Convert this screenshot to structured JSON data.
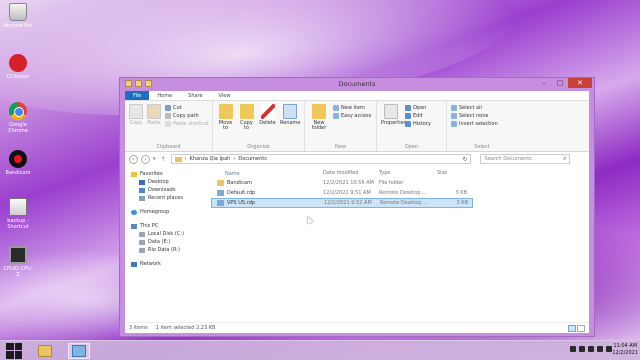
{
  "desktop": {
    "icons": [
      {
        "label": "Recycle Bin"
      },
      {
        "label": "CCleaner"
      },
      {
        "label": "Google Chrome"
      },
      {
        "label": "Bandicam"
      },
      {
        "label": "backup - Shortcut"
      },
      {
        "label": "CPUID CPU-Z"
      }
    ]
  },
  "window": {
    "title": "Documents",
    "tabs": [
      "File",
      "Home",
      "Share",
      "View"
    ],
    "ribbon": {
      "clipboard": {
        "name": "Clipboard",
        "copy": "Copy",
        "paste": "Paste",
        "cut": "Cut",
        "copy_path": "Copy path",
        "paste_shortcut": "Paste shortcut"
      },
      "organize": {
        "name": "Organize",
        "move_to": "Move to",
        "copy_to": "Copy to",
        "delete": "Delete",
        "rename": "Rename"
      },
      "new": {
        "name": "New",
        "new_folder": "New folder",
        "new_item": "New item",
        "easy_access": "Easy access"
      },
      "open": {
        "name": "Open",
        "properties": "Properties",
        "open": "Open",
        "edit": "Edit",
        "history": "History"
      },
      "select": {
        "name": "Select",
        "select_all": "Select all",
        "select_none": "Select none",
        "invert_selection": "Invert selection"
      }
    },
    "address": {
      "path_root": "Khanza Qia Ipah",
      "separator": "›",
      "path_current": "Documents",
      "search_placeholder": "Search Documents"
    },
    "nav": {
      "favorites": "Favorites",
      "desktop": "Desktop",
      "downloads": "Downloads",
      "recent": "Recent places",
      "homegroup": "Homegroup",
      "this_pc": "This PC",
      "local_disk": "Local Disk (C:)",
      "data_e": "Data (E:)",
      "rio_data": "Rio Data (R:)",
      "network": "Network"
    },
    "columns": {
      "name": "Name",
      "date": "Date modified",
      "type": "Type",
      "size": "Size"
    },
    "files": [
      {
        "name": "Bandicam",
        "date": "12/2/2021 10:56 AM",
        "type": "File folder",
        "size": ""
      },
      {
        "name": "Default.rdp",
        "date": "12/2/2021 9:51 AM",
        "type": "Remote Desktop ...",
        "size": "3 KB"
      },
      {
        "name": "VPS US.rdp",
        "date": "12/2/2021 9:52 AM",
        "type": "Remote Desktop ...",
        "size": "3 KB"
      }
    ],
    "status": {
      "items": "3 items",
      "selected": "1 item selected  2,23 KB"
    }
  },
  "taskbar": {
    "time": "11:04 AM",
    "date": "12/2/2021"
  },
  "colors": {
    "ribbon_file_tab": "#1f6fbf",
    "selection": "#cce4f7",
    "window_frame": "#c58ede",
    "close_button": "#c7403a"
  }
}
